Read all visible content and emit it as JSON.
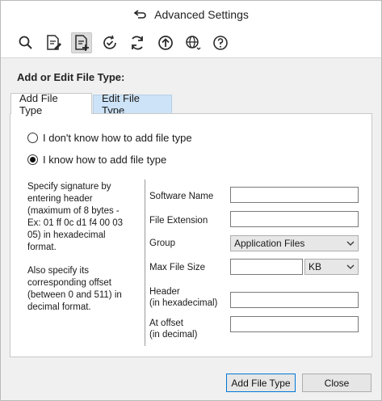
{
  "window": {
    "title": "Advanced Settings",
    "back_icon": "back-arrow-icon"
  },
  "toolbar": {
    "items": [
      {
        "icon": "search-icon",
        "active": false
      },
      {
        "icon": "document-edit-icon",
        "active": false
      },
      {
        "icon": "document-add-icon",
        "active": true
      },
      {
        "icon": "clock-check-icon",
        "active": false
      },
      {
        "icon": "refresh-icon",
        "active": false
      },
      {
        "icon": "upload-icon",
        "active": false
      },
      {
        "icon": "globe-settings-icon",
        "active": false
      },
      {
        "icon": "help-icon",
        "active": false
      }
    ]
  },
  "section": {
    "heading": "Add or Edit File Type:"
  },
  "tabs": [
    {
      "label": "Add File Type",
      "active": true
    },
    {
      "label": "Edit File Type",
      "active": false
    }
  ],
  "radios": [
    {
      "label": "I don't know how to add file type",
      "checked": false
    },
    {
      "label": "I know how to add file type",
      "checked": true
    }
  ],
  "description": {
    "signature": "Specify signature by entering header (maximum of 8 bytes - Ex: 01 ff 0c d1 f4 00 03 05) in hexadecimal format.",
    "offset": "Also specify its corresponding offset (between 0 and 511) in decimal format."
  },
  "form": {
    "software_name": {
      "label": "Software Name",
      "value": ""
    },
    "file_extension": {
      "label": "File Extension",
      "value": ""
    },
    "group": {
      "label": "Group",
      "value": "Application Files"
    },
    "max_file_size": {
      "label": "Max File Size",
      "value": "",
      "unit": "KB"
    },
    "header": {
      "label_line1": "Header",
      "label_line2": "(in hexadecimal)",
      "value": ""
    },
    "offset": {
      "label_line1": "At offset",
      "label_line2": "(in decimal)",
      "value": ""
    }
  },
  "buttons": {
    "add": "Add File Type",
    "close": "Close"
  },
  "colors": {
    "accent": "#0078d7",
    "inactive_tab": "#cde3f7",
    "icon": "#2b2b2b"
  }
}
